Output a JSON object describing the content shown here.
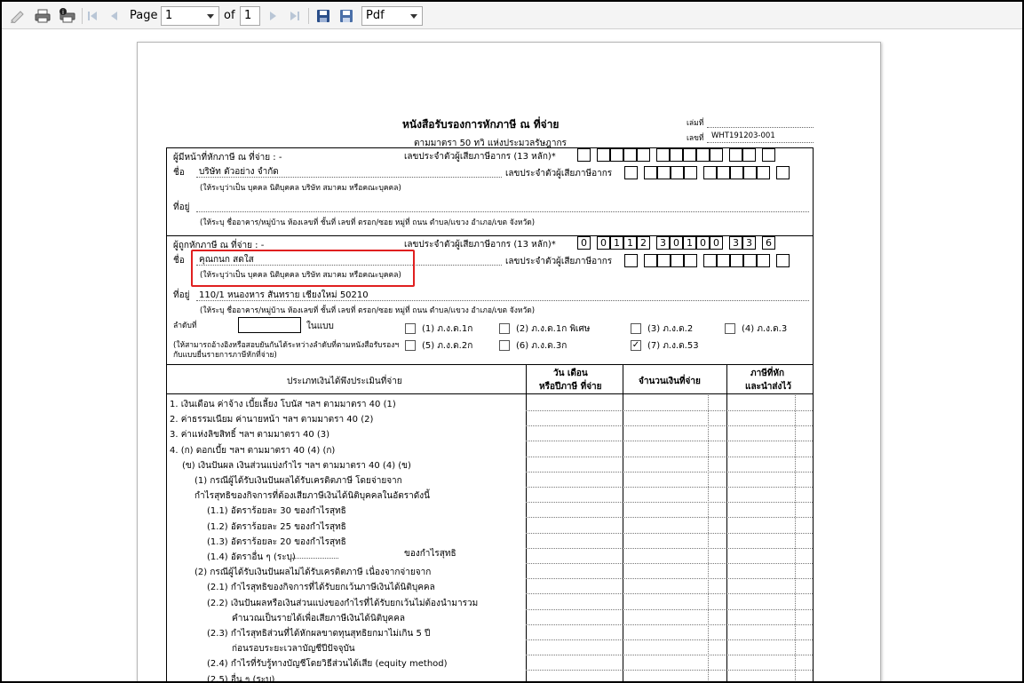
{
  "toolbar": {
    "page_label": "Page",
    "page_value": "1",
    "of_label": "of",
    "total_pages": "1",
    "format_value": "Pdf"
  },
  "doc": {
    "title": "หนังสือรับรองการหักภาษี ณ ที่จ่าย",
    "subtitle": "ตามมาตรา 50 ทวิ แห่งประมวลรัษฎากร",
    "book_no_label": "เล่มที่",
    "doc_no_label": "เลขที่",
    "doc_no_value": "WHT191203-001",
    "payer": {
      "heading": "ผู้มีหน้าที่หักภาษี ณ ที่จ่าย : -",
      "tax_id_label": "เลขประจำตัวผู้เสียภาษีอากร (13 หลัก)*",
      "name_label": "ชื่อ",
      "name_value": "บริษัท ตัวอย่าง จำกัด",
      "tax_id2_label": "เลขประจำตัวผู้เสียภาษีอากร",
      "name_hint": "(ให้ระบุว่าเป็น บุคคล นิติบุคคล บริษัท สมาคม หรือคณะบุคคล)",
      "address_label": "ที่อยู่",
      "address_hint": "(ให้ระบุ ชื่ออาคาร/หมู่บ้าน ห้องเลขที่ ชั้นที่ เลขที่ ตรอก/ซอย หมู่ที่ ถนน ตำบล/แขวง อำเภอ/เขต จังหวัด)"
    },
    "payee": {
      "heading": "ผู้ถูกหักภาษี ณ ที่จ่าย : -",
      "tax_id_label": "เลขประจำตัวผู้เสียภาษีอากร (13 หลัก)*",
      "tax_id_digits": [
        "0",
        "0",
        "1",
        "1",
        "2",
        "3",
        "0",
        "1",
        "0",
        "0",
        "3",
        "3",
        "6"
      ],
      "name_label": "ชื่อ",
      "name_value": "คุณกนก สดใส",
      "tax_id2_label": "เลขประจำตัวผู้เสียภาษีอากร",
      "name_hint": "(ให้ระบุว่าเป็น บุคคล นิติบุคคล บริษัท สมาคม หรือคณะบุคคล)",
      "address_label": "ที่อยู่",
      "address_value": "110/1 หนองหาร สันทราย เชียงใหม่ 50210",
      "address_hint": "(ให้ระบุ ชื่ออาคาร/หมู่บ้าน ห้องเลขที่ ชั้นที่ เลขที่ ตรอก/ซอย หมู่ที่ ถนน ตำบล/แขวง อำเภอ/เขต จังหวัด)"
    },
    "sequence_label": "ลำดับที่",
    "in_form_label": "ในแบบ",
    "sequence_hint_1": "(ให้สามารถอ้างอิงหรือสอบยันกันได้ระหว่างลำดับที่ตามหนังสือรับรองฯ",
    "sequence_hint_2": "กับแบบยื่นรายการภาษีหักที่จ่าย)",
    "forms": [
      {
        "label": "(1) ภ.ง.ด.1ก",
        "checked": false
      },
      {
        "label": "(2) ภ.ง.ด.1ก พิเศษ",
        "checked": false
      },
      {
        "label": "(3) ภ.ง.ด.2",
        "checked": false
      },
      {
        "label": "(4) ภ.ง.ด.3",
        "checked": false
      },
      {
        "label": "(5) ภ.ง.ด.2ก",
        "checked": false
      },
      {
        "label": "(6) ภ.ง.ด.3ก",
        "checked": false
      },
      {
        "label": "(7) ภ.ง.ด.53",
        "checked": true
      }
    ],
    "table": {
      "col_type": "ประเภทเงินได้พึงประเมินที่จ่าย",
      "col_date_1": "วัน เดือน",
      "col_date_2": "หรือปีภาษี ที่จ่าย",
      "col_amount": "จำนวนเงินที่จ่าย",
      "col_tax_1": "ภาษีที่หัก",
      "col_tax_2": "และนำส่งไว้",
      "rows": [
        "1. เงินเดือน ค่าจ้าง เบี้ยเลี้ยง โบนัส ฯลฯ ตามมาตรา 40 (1)",
        "2. ค่าธรรมเนียม ค่านายหน้า ฯลฯ ตามมาตรา 40 (2)",
        "3. ค่าแห่งลิขสิทธิ์ ฯลฯ ตามมาตรา 40 (3)",
        "4. (ก) ดอกเบี้ย ฯลฯ ตามมาตรา 40 (4) (ก)",
        "(ข) เงินปันผล เงินส่วนแบ่งกำไร ฯลฯ ตามมาตรา 40 (4) (ข)",
        "(1) กรณีผู้ได้รับเงินปันผลได้รับเครดิตภาษี โดยจ่ายจาก",
        "กำไรสุทธิของกิจการที่ต้องเสียภาษีเงินได้นิติบุคคลในอัตราดังนี้",
        "(1.1) อัตราร้อยละ 30 ของกำไรสุทธิ",
        "(1.2) อัตราร้อยละ 25 ของกำไรสุทธิ",
        "(1.3) อัตราร้อยละ 20 ของกำไรสุทธิ",
        "(1.4) อัตราอื่น ๆ (ระบุ)",
        "(2) กรณีผู้ได้รับเงินปันผลไม่ได้รับเครดิตภาษี เนื่องจากจ่ายจาก",
        "(2.1) กำไรสุทธิของกิจการที่ได้รับยกเว้นภาษีเงินได้นิติบุคคล",
        "(2.2) เงินปันผลหรือเงินส่วนแบ่งของกำไรที่ได้รับยกเว้นไม่ต้องนำมารวม",
        "คำนวณเป็นรายได้เพื่อเสียภาษีเงินได้นิติบุคคล",
        "(2.3) กำไรสุทธิส่วนที่ได้หักผลขาดทุนสุทธิยกมาไม่เกิน 5 ปี",
        "ก่อนรอบระยะเวลาบัญชีปีปัจจุบัน",
        "(2.4) กำไรที่รับรู้ทางบัญชีโดยวิธีส่วนได้เสีย (equity method)",
        "(2.5) อื่น ๆ (ระบุ)"
      ],
      "row_1_4_suffix": "ของกำไรสุทธิ"
    }
  }
}
